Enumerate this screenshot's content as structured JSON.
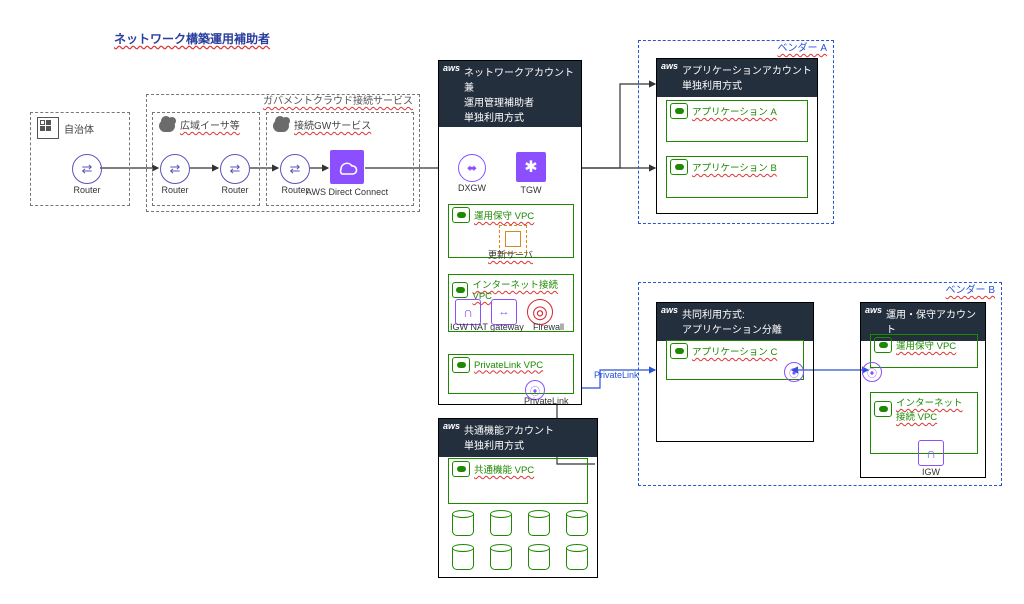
{
  "title": "ネットワーク構築運用補助者",
  "onprem": {
    "name": "自治体",
    "router": "Router"
  },
  "gov_service": {
    "group_label": "ガバメントクラウド接続サービス",
    "wan": {
      "label": "広域イーサ等",
      "router": "Router"
    },
    "gw": {
      "label": "接続GWサービス",
      "router": "Router",
      "dx": "AWS Direct Connect"
    }
  },
  "network_account": {
    "title": "ネットワークアカウント兼\n運用管理補助者\n単独利用方式",
    "dxgw": "DXGW",
    "tgw": "TGW",
    "vpc_ops": {
      "name": "運用保守 VPC",
      "server": "更新サーバ"
    },
    "vpc_inet": {
      "name": "インターネット接続 VPC",
      "igw": "IGW",
      "nat": "NAT gateway",
      "fw": "Firewall"
    },
    "vpc_plink": {
      "name": "PrivateLink VPC",
      "endpoint": "PrivateLink"
    }
  },
  "vendor_a": {
    "label": "ベンダー A",
    "account": {
      "title": "アプリケーションアカウント\n単独利用方式",
      "app1": "アプリケーション A",
      "app2": "アプリケーション B"
    }
  },
  "vendor_b": {
    "label": "ベンダー B",
    "shared": {
      "title": "共同利用方式:\nアプリケーション分離",
      "app": "アプリケーション C"
    },
    "ops": {
      "title": "運用・保守アカウント",
      "vpc_ops": "運用保守 VPC",
      "vpc_inet": "インターネット\n接続 VPC",
      "igw": "IGW"
    }
  },
  "common": {
    "title": "共通機能アカウント\n単独利用方式",
    "vpc": "共通機能 VPC"
  },
  "link_label": "PrivateLink"
}
